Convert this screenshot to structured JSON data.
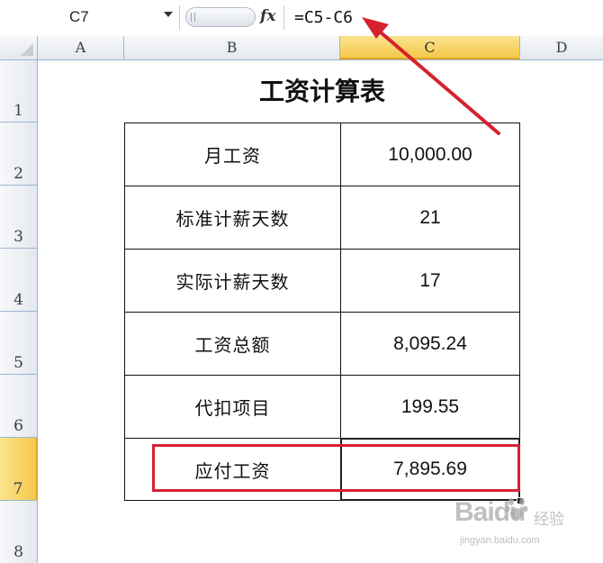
{
  "formula_bar": {
    "name_box": "C7",
    "fx_label": "fx",
    "formula": "=C5-C6"
  },
  "columns": [
    "A",
    "B",
    "C",
    "D"
  ],
  "active_column": "C",
  "rows": [
    "1",
    "2",
    "3",
    "4",
    "5",
    "6",
    "7",
    "8"
  ],
  "active_row": "7",
  "sheet": {
    "title": "工资计算表",
    "table": [
      {
        "label": "月工资",
        "value": "10,000.00"
      },
      {
        "label": "标准计薪天数",
        "value": "21"
      },
      {
        "label": "实际计薪天数",
        "value": "17"
      },
      {
        "label": "工资总额",
        "value": "8,095.24"
      },
      {
        "label": "代扣项目",
        "value": "199.55"
      },
      {
        "label": "应付工资",
        "value": "7,895.69"
      }
    ]
  },
  "colors": {
    "annotation_red": "#d6222e",
    "active_header": "#f5c84a",
    "header_border": "#9eb6ce"
  },
  "watermark": {
    "brand": "Baidu",
    "brand_cn": "经验",
    "url": "jingyan.baidu.com"
  }
}
